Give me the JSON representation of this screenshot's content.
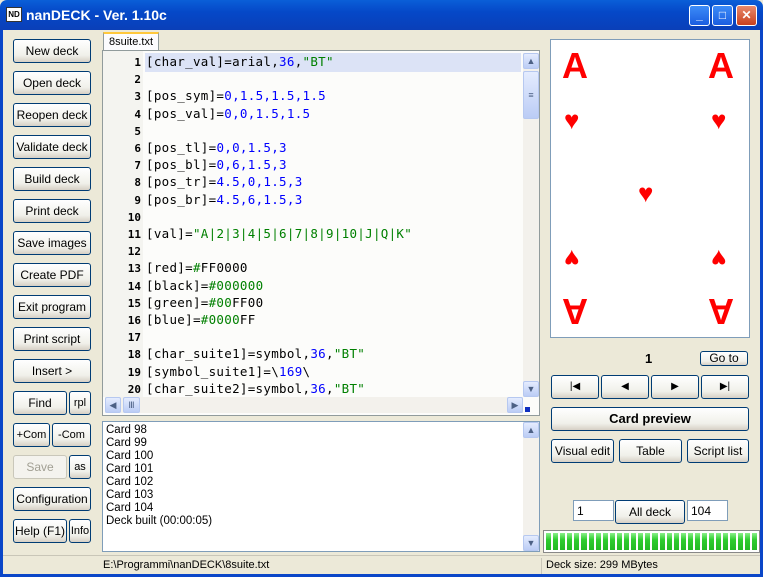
{
  "window": {
    "title": "nanDECK - Ver. 1.10c",
    "icon_label": "ND"
  },
  "left_buttons": {
    "new_deck": "New deck",
    "open_deck": "Open deck",
    "reopen_deck": "Reopen deck",
    "validate_deck": "Validate deck",
    "build_deck": "Build deck",
    "print_deck": "Print deck",
    "save_images": "Save images",
    "create_pdf": "Create PDF",
    "exit_program": "Exit program",
    "print_script": "Print script",
    "insert": "Insert >",
    "find": "Find",
    "rpl": "rpl",
    "add_com": "+Com",
    "rem_com": "-Com",
    "save": "Save",
    "save_as": "as",
    "configuration": "Configuration",
    "help": "Help (F1)",
    "info": "Info"
  },
  "editor": {
    "tab": "8suite.txt",
    "lines": [
      [
        [
          "[char_val]=arial,",
          "k"
        ],
        [
          "36",
          "n"
        ],
        [
          ",",
          ""
        ],
        [
          "\"BT\"",
          "s"
        ]
      ],
      [],
      [
        [
          "[pos_sym]=",
          "k"
        ],
        [
          "0,1.5,1.5,1.5",
          "n"
        ]
      ],
      [
        [
          "[pos_val]=",
          "k"
        ],
        [
          "0,0,1.5,1.5",
          "n"
        ]
      ],
      [],
      [
        [
          "[pos_tl]=",
          "k"
        ],
        [
          "0,0,1.5,3",
          "n"
        ]
      ],
      [
        [
          "[pos_bl]=",
          "k"
        ],
        [
          "0,6,1.5,3",
          "n"
        ]
      ],
      [
        [
          "[pos_tr]=",
          "k"
        ],
        [
          "4.5,0,1.5,3",
          "n"
        ]
      ],
      [
        [
          "[pos_br]=",
          "k"
        ],
        [
          "4.5,6,1.5,3",
          "n"
        ]
      ],
      [],
      [
        [
          "[val]=",
          "k"
        ],
        [
          "\"A|2|3|4|5|6|7|8|9|10|J|Q|K\"",
          "s"
        ]
      ],
      [],
      [
        [
          "[red]=",
          "k"
        ],
        [
          "#",
          "s"
        ],
        [
          "FF0000",
          "k"
        ]
      ],
      [
        [
          "[black]=",
          "k"
        ],
        [
          "#000000",
          "s"
        ]
      ],
      [
        [
          "[green]=",
          "k"
        ],
        [
          "#00",
          "s"
        ],
        [
          "FF00",
          "k"
        ]
      ],
      [
        [
          "[blue]=",
          "k"
        ],
        [
          "#0000",
          "s"
        ],
        [
          "FF",
          "k"
        ]
      ],
      [],
      [
        [
          "[char_suite1]=symbol,",
          "k"
        ],
        [
          "36",
          "n"
        ],
        [
          ",",
          ""
        ],
        [
          "\"BT\"",
          "s"
        ]
      ],
      [
        [
          "[symbol_suite1]=\\",
          "k"
        ],
        [
          "169",
          "n"
        ],
        [
          "\\",
          ""
        ]
      ],
      [
        [
          "[char_suite2]=symbol,",
          "k"
        ],
        [
          "36",
          "n"
        ],
        [
          ",",
          ""
        ],
        [
          "\"BT\"",
          "s"
        ]
      ]
    ]
  },
  "log": [
    "Card 98",
    "Card 99",
    "Card 100",
    "Card 101",
    "Card 102",
    "Card 103",
    "Card 104",
    "Deck built (00:00:05)"
  ],
  "preview": {
    "value": "A",
    "suit_symbol": "♥",
    "card_color": "#FF0000",
    "card_number": "1",
    "goto": "Go to",
    "first": "|◀",
    "prev": "◀",
    "next": "▶",
    "last": "▶|",
    "card_preview": "Card preview",
    "visual_edit": "Visual edit",
    "table": "Table",
    "script_list": "Script list",
    "range_from": "1",
    "all_deck": "All deck",
    "range_to": "104",
    "progress_percent": 100
  },
  "status": {
    "path": "E:\\Programmi\\nanDECK\\8suite.txt",
    "deck_size": "Deck size: 299 MBytes"
  },
  "colors": {
    "keyword": "#000000",
    "number": "#0000FF",
    "string": "#008000",
    "title": "#0548C8"
  }
}
